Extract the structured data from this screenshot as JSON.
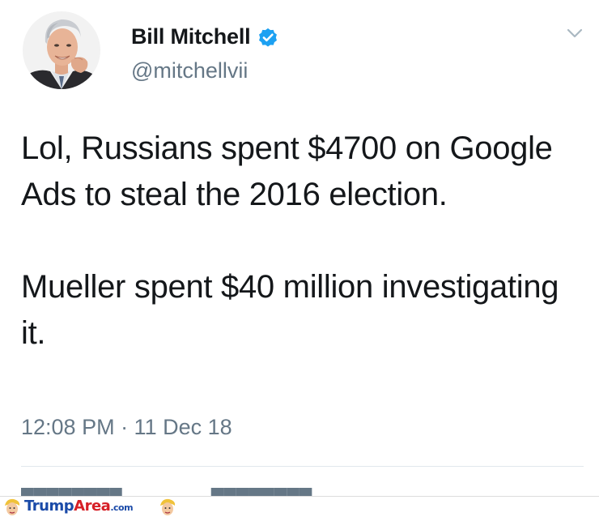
{
  "author": {
    "display_name": "Bill Mitchell",
    "handle": "@mitchellvii",
    "verified": true,
    "avatar_icon": "profile-photo"
  },
  "tweet": {
    "paragraphs": [
      "Lol, Russians spent $4700 on Google Ads to steal the 2016 election.",
      "Mueller spent $40 million investigating it."
    ],
    "timestamp": "12:08 PM · 11 Dec 18"
  },
  "icons": {
    "verified": "verified-badge-icon",
    "menu": "chevron-down-icon"
  },
  "watermark": {
    "brand_1": "Trump",
    "brand_2": "Area",
    "brand_3": ".com"
  },
  "colors": {
    "text": "#14171a",
    "muted": "#657786",
    "verified_blue": "#1da1f2",
    "divider": "#e1e8ed",
    "watermark_blue": "#1a4aa8",
    "watermark_red": "#d61f26"
  }
}
